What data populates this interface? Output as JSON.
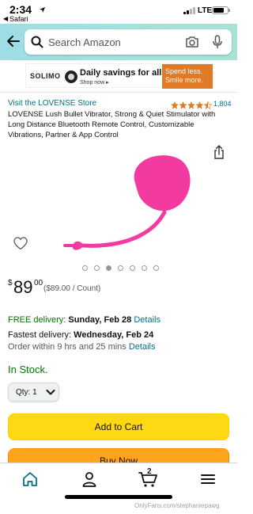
{
  "status_bar": {
    "time": "2:34",
    "back_app": "Safari",
    "network": "LTE"
  },
  "search": {
    "placeholder": "Search Amazon"
  },
  "banner": {
    "brand": "SOLIMO",
    "title": "Daily savings for all",
    "cta": "Shop now ▸",
    "offer_line1": "Spend less.",
    "offer_line2": "Smile more."
  },
  "product": {
    "store_link": "Visit the LOVENSE Store",
    "rating_stars": 4.5,
    "rating_count": "1,804",
    "title": "LOVENSE Lush Bullet Vibrator, Strong & Quiet Stimulator with Long Distance Bluetooth Remote Control, Customizable Vibrations, Partner & App Control",
    "image_color": "#f23aa0",
    "carousel_count": 7,
    "carousel_active_index": 3
  },
  "price": {
    "symbol": "$",
    "whole": "89",
    "fraction": "00",
    "per_unit": "($89.00 / Count)"
  },
  "delivery": {
    "free_label": "FREE delivery:",
    "free_date": "Sunday, Feb 28",
    "free_details": "Details",
    "fastest_label": "Fastest delivery:",
    "fastest_date": "Wednesday, Feb 24",
    "order_within": "Order within 9 hrs and 25 mins",
    "order_details": "Details"
  },
  "stock": "In Stock.",
  "quantity": {
    "label": "Qty:",
    "value": "1"
  },
  "buttons": {
    "add_to_cart": "Add to Cart",
    "buy_now": "Buy Now"
  },
  "bottom_nav": {
    "cart_count": "2"
  },
  "watermark": "OnlyFans.com/stephaniepawg",
  "colors": {
    "header_bg": "#a8e0e8",
    "link": "#007185",
    "in_stock": "#007600",
    "add_to_cart": "#ffd814",
    "buy_now": "#ffa41c",
    "banner_offer": "#e07a26"
  }
}
